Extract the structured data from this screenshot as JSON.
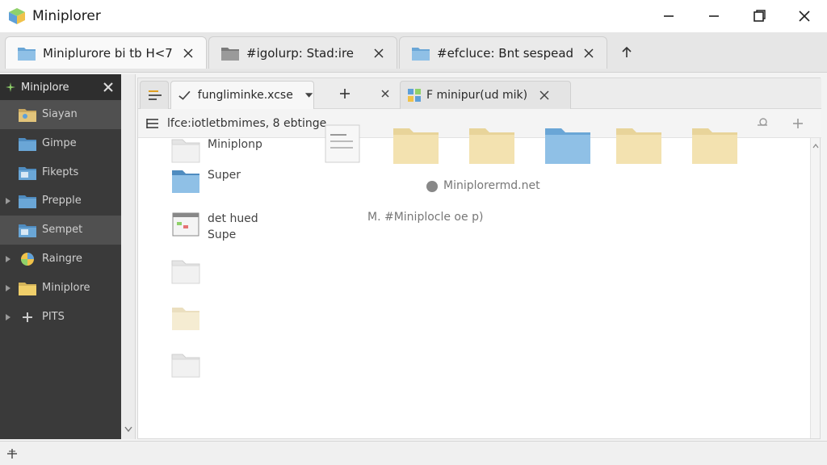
{
  "window": {
    "title": "Miniplorer"
  },
  "tabs": [
    {
      "label": "Miniplurore bi tb H<7",
      "icon": "folder-blue-icon",
      "active": true
    },
    {
      "label": "#igolurp: Stad:ire",
      "icon": "folder-gray-icon",
      "active": false
    },
    {
      "label": "#efcluce: Bnt sespead",
      "icon": "folder-blue-icon",
      "active": false
    }
  ],
  "sidebar": {
    "title": "Miniplore",
    "items": [
      {
        "label": "Siayan",
        "icon": "user-folder-icon",
        "expandable": false,
        "highlight": true
      },
      {
        "label": "Gimpe",
        "icon": "folder-blue-icon",
        "expandable": false,
        "highlight": false
      },
      {
        "label": "Fikepts",
        "icon": "image-folder-icon",
        "expandable": false,
        "highlight": false
      },
      {
        "label": "Prepple",
        "icon": "folder-blue-icon",
        "expandable": true,
        "highlight": false
      },
      {
        "label": "Sempet",
        "icon": "image-folder-icon",
        "expandable": false,
        "highlight": true
      },
      {
        "label": "Raingre",
        "icon": "color-circle-icon",
        "expandable": true,
        "highlight": false
      },
      {
        "label": "Miniplore",
        "icon": "folder-yellow-icon",
        "expandable": true,
        "highlight": false
      },
      {
        "label": "PITS",
        "icon": "plus-icon",
        "expandable": true,
        "highlight": false
      }
    ]
  },
  "inner_tabs": [
    {
      "label": "fungliminke.xcse",
      "icon": "check-icon"
    },
    {
      "label": "F minipur(ud mik)",
      "icon": "grid-icon"
    }
  ],
  "toolbar": {
    "label": "lfce:iotletbmimes, 8 ebtinge"
  },
  "list": [
    {
      "label": "Miniplonp",
      "icon": "folder-white-icon"
    },
    {
      "label": "Super",
      "icon": "folder-blue-icon"
    },
    {
      "label": "det hued\nSupe",
      "icon": "app-window-icon"
    },
    {
      "label": "",
      "icon": "folder-white-icon"
    },
    {
      "label": "",
      "icon": "folder-cream-icon"
    },
    {
      "label": "",
      "icon": "folder-white-icon"
    }
  ],
  "info": {
    "line1": "Miniplorermd.net",
    "line2": "M. #Miniplocle oe p)"
  },
  "colors": {
    "folder_yellow": "#f3e2b0",
    "folder_blue": "#8fc0e6",
    "sidebar_bg": "#3a3a3a"
  }
}
